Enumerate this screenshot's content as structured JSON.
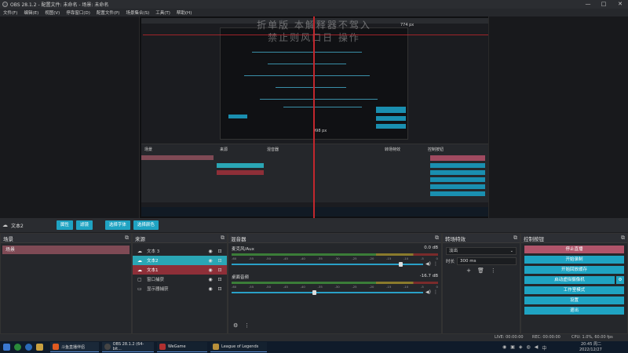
{
  "window": {
    "title": "OBS 28.1.2 - 配置文件: 未命名 - 场景: 未命名",
    "minimize": "—",
    "maximize": "□",
    "close": "✕"
  },
  "menu": [
    "文件(F)",
    "编辑(E)",
    "视图(V)",
    "停靠窗口(D)",
    "配置文件(P)",
    "场景集合(S)",
    "工具(T)",
    "帮助(H)"
  ],
  "preview_overlay": {
    "line1": "折单版 本解释器不驾入",
    "line2": "禁止则风口日 操作"
  },
  "nested_labels": {
    "size_top": "774 px",
    "size_mid": "998 px",
    "scene_tab": "场景",
    "sources_tab": "来源",
    "mixer_tab": "混音器",
    "transition_tab": "转场特效",
    "controls_tab": "控制按钮"
  },
  "source_toolbar": {
    "selected_source": "文本2",
    "buttons": [
      "属性",
      "滤镜",
      "选择字体",
      "选择颜色"
    ]
  },
  "scenes": {
    "title": "场景",
    "items": [
      "场景"
    ]
  },
  "sources": {
    "title": "来源",
    "items": [
      {
        "icon": "☁",
        "label": "文本 3",
        "state": "normal"
      },
      {
        "icon": "☁",
        "label": "文本2",
        "state": "teal"
      },
      {
        "icon": "☁",
        "label": "文本1",
        "state": "red"
      },
      {
        "icon": "▢",
        "label": "窗口捕获",
        "state": "normal"
      },
      {
        "icon": "▭",
        "label": "显示器捕获",
        "state": "normal"
      }
    ]
  },
  "mixer": {
    "title": "混音器",
    "channels": [
      {
        "name": "麦克风/Aux",
        "db": "0.0 dB",
        "level": 0.88
      },
      {
        "name": "桌面音频",
        "db": "-16.7 dB",
        "level": 0.43
      }
    ],
    "scale": [
      "-60",
      "-55",
      "-50",
      "-45",
      "-40",
      "-35",
      "-30",
      "-25",
      "-20",
      "-15",
      "-10",
      "-5",
      "0"
    ]
  },
  "transitions": {
    "title": "转场特效",
    "selected": "淡出",
    "duration_label": "时长",
    "duration_value": "300 ms"
  },
  "controls": {
    "title": "控制按钮",
    "buttons": [
      "停止直播",
      "开始录制",
      "开始回放缓存",
      "启动虚拟摄像机",
      "工作室模式",
      "设置",
      "退出"
    ]
  },
  "status": {
    "live": "LIVE: 00:00:00",
    "rec": "REC: 00:00:00",
    "cpu": "CPU: 1.0%, 60.00 fps"
  },
  "taskbar": {
    "apps": [
      "斗鱼直播伴侣",
      "OBS 28.1.2 (64-bit...",
      "WeGame",
      "League of Legends"
    ],
    "time": "20:45 周二",
    "date": "2022/12/27"
  },
  "colors": {
    "accent": "#1fa3c2",
    "selected_scene": "#7f4a55",
    "stop_stream": "#b0546a",
    "red_guide": "#c2272d"
  }
}
